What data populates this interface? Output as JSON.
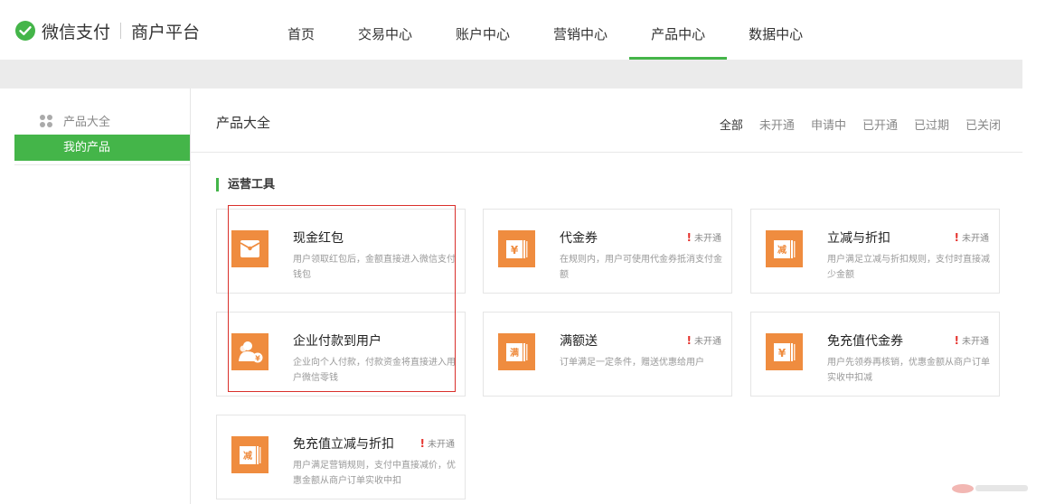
{
  "app": {
    "name": "微信支付",
    "subtitle": "商户平台"
  },
  "nav": [
    "首页",
    "交易中心",
    "账户中心",
    "营销中心",
    "产品中心",
    "数据中心"
  ],
  "nav_active": "产品中心",
  "sidebar": {
    "header": "产品大全",
    "items": [
      {
        "label": "我的产品"
      }
    ]
  },
  "main": {
    "title": "产品大全",
    "filters": [
      "全部",
      "未开通",
      "申请中",
      "已开通",
      "已过期",
      "已关闭"
    ],
    "active_filter": "全部",
    "section_title": "运营工具"
  },
  "cards": [
    {
      "name": "现金红包",
      "desc": "用户领取红包后，金额直接进入微信支付钱包",
      "status": "",
      "icon": "red-envelope-icon"
    },
    {
      "name": "代金券",
      "desc": "在规则内，用户可使用代金券抵消支付金额",
      "status": "未开通",
      "icon": "yen-voucher-icon"
    },
    {
      "name": "立减与折扣",
      "desc": "用户满足立减与折扣规则，支付时直接减少金额",
      "status": "未开通",
      "icon": "discount-voucher-icon"
    },
    {
      "name": "企业付款到用户",
      "desc": "企业向个人付款，付款资金将直接进入用户微信零钱",
      "status": "",
      "icon": "enterprise-pay-icon"
    },
    {
      "name": "满额送",
      "desc": "订单满足一定条件，赠送优惠给用户",
      "status": "未开通",
      "icon": "full-gift-icon"
    },
    {
      "name": "免充值代金券",
      "desc": "用户先领券再核销，优惠金额从商户订单实收中扣减",
      "status": "未开通",
      "icon": "yen-voucher-icon"
    },
    {
      "name": "免充值立减与折扣",
      "desc": "用户满足营销规则，支付中直接减价，优惠金额从商户订单实收中扣",
      "status": "未开通",
      "icon": "discount-voucher-icon"
    }
  ],
  "status_mark": "!",
  "colors": {
    "accent": "#44b549",
    "icon_bg": "#ef8c3f",
    "highlight": "#d9302b",
    "status_mark": "#e5342f"
  }
}
